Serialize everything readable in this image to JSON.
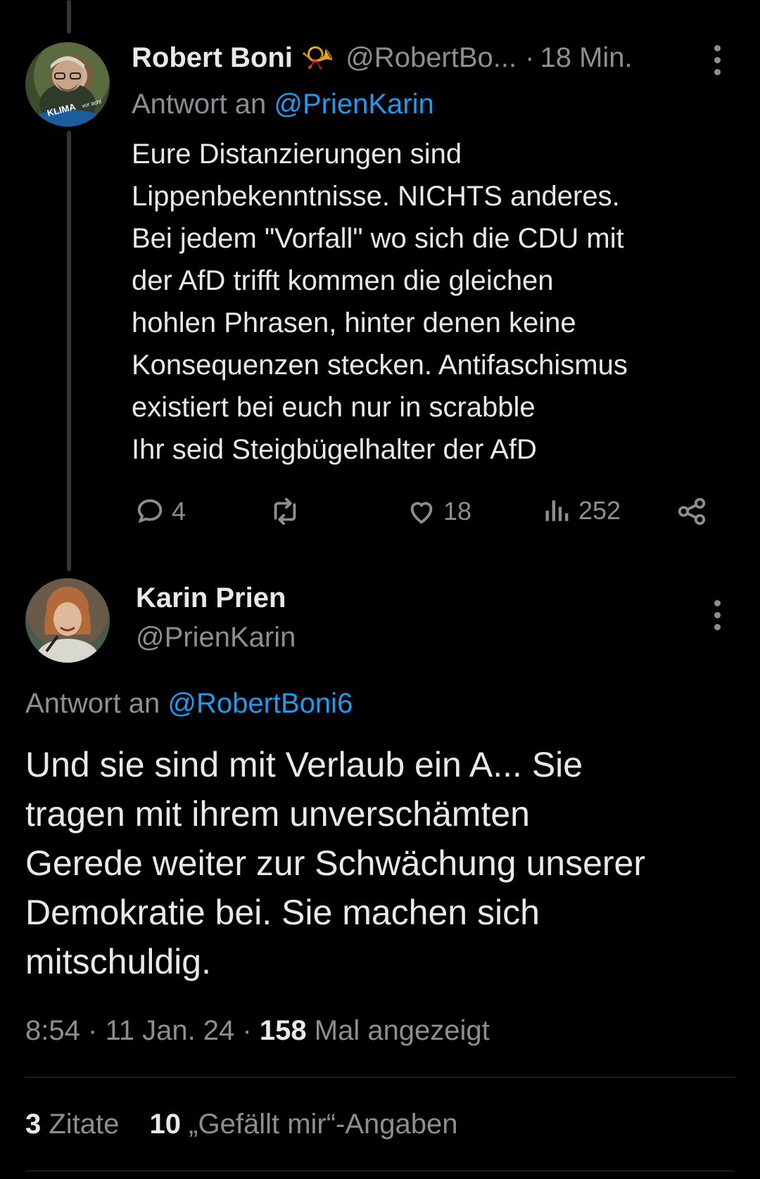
{
  "reply_tweet": {
    "author_name": "Robert Boni",
    "author_emoji": "📯",
    "author_handle": "@RobertBo...",
    "time_sep": "·",
    "time": "18 Min.",
    "reply_prefix": "Antwort an",
    "reply_to": "@PrienKarin",
    "avatar_badge": "KLIMA",
    "avatar_badge_sub": "vor acht",
    "text_lines": [
      "Eure Distanzierungen sind",
      "Lippenbekenntnisse. NICHTS anderes.",
      "Bei jedem \"Vorfall\" wo sich die CDU mit",
      "der AfD trifft kommen die gleichen",
      "hohlen Phrasen, hinter denen keine",
      "Konsequenzen stecken. Antifaschismus",
      "existiert bei euch nur in scrabble",
      "Ihr seid Steigbügelhalter der AfD"
    ],
    "replies": "4",
    "likes": "18",
    "views": "252"
  },
  "main_tweet": {
    "author_name": "Karin Prien",
    "author_handle": "@PrienKarin",
    "reply_prefix": "Antwort an",
    "reply_to": "@RobertBoni6",
    "text_lines": [
      "Und sie sind mit Verlaub ein A... Sie",
      "tragen mit ihrem unverschämten",
      "Gerede weiter zur Schwächung unserer",
      "Demokratie bei. Sie machen sich",
      "mitschuldig."
    ],
    "time": "8:54",
    "date": "11 Jan. 24",
    "sep": "·",
    "views_count": "158",
    "views_label": "Mal angezeigt",
    "quotes_count": "3",
    "quotes_label": "Zitate",
    "likes_count": "10",
    "likes_label": "„Gefällt mir“-Angaben"
  },
  "colors": {
    "background": "#000000",
    "text": "#e7e9ea",
    "secondary": "#8b8f94",
    "link": "#1d9bf0",
    "divider": "#2f3336"
  }
}
